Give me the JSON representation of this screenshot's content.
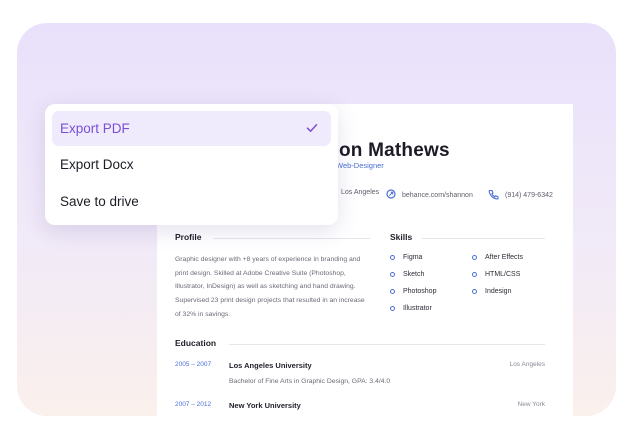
{
  "menu": {
    "items": [
      {
        "label": "Export PDF",
        "selected": true
      },
      {
        "label": "Export Docx",
        "selected": false
      },
      {
        "label": "Save to drive",
        "selected": false
      }
    ]
  },
  "resume": {
    "name": "on Mathews",
    "role": "Web-Designer",
    "contact": {
      "city": "Los Angeles",
      "website": "behance.com/shannon",
      "phone": "(914) 479-6342"
    },
    "profile": {
      "title": "Profile",
      "text": "Graphic designer with +8 years of experience in branding and print design. Skilled at Adobe Creative Suite (Photoshop, Illustrator, InDesign) as well as sketching and hand drawing. Supervised 23 print design projects that resulted in an increase of 32% in savings."
    },
    "skills": {
      "title": "Skills",
      "items": [
        "Figma",
        "Sketch",
        "Photoshop",
        "Illustrator",
        "After Effects",
        "HTML/CSS",
        "Indesign"
      ]
    },
    "education": {
      "title": "Education",
      "entries": [
        {
          "years": "2005 – 2007",
          "school": "Los Angeles University",
          "location": "Los Angeles",
          "degree": "Bachelor of Fine Arts in Graphic Design, GPA: 3.4/4.0"
        },
        {
          "years": "2007 – 2012",
          "school": "New York University",
          "location": "New York",
          "degree": ""
        }
      ]
    }
  },
  "colors": {
    "accent": "#4b6fd6",
    "menu_selected_bg": "#f0ebfc",
    "menu_selected_text": "#7a4fd6"
  }
}
